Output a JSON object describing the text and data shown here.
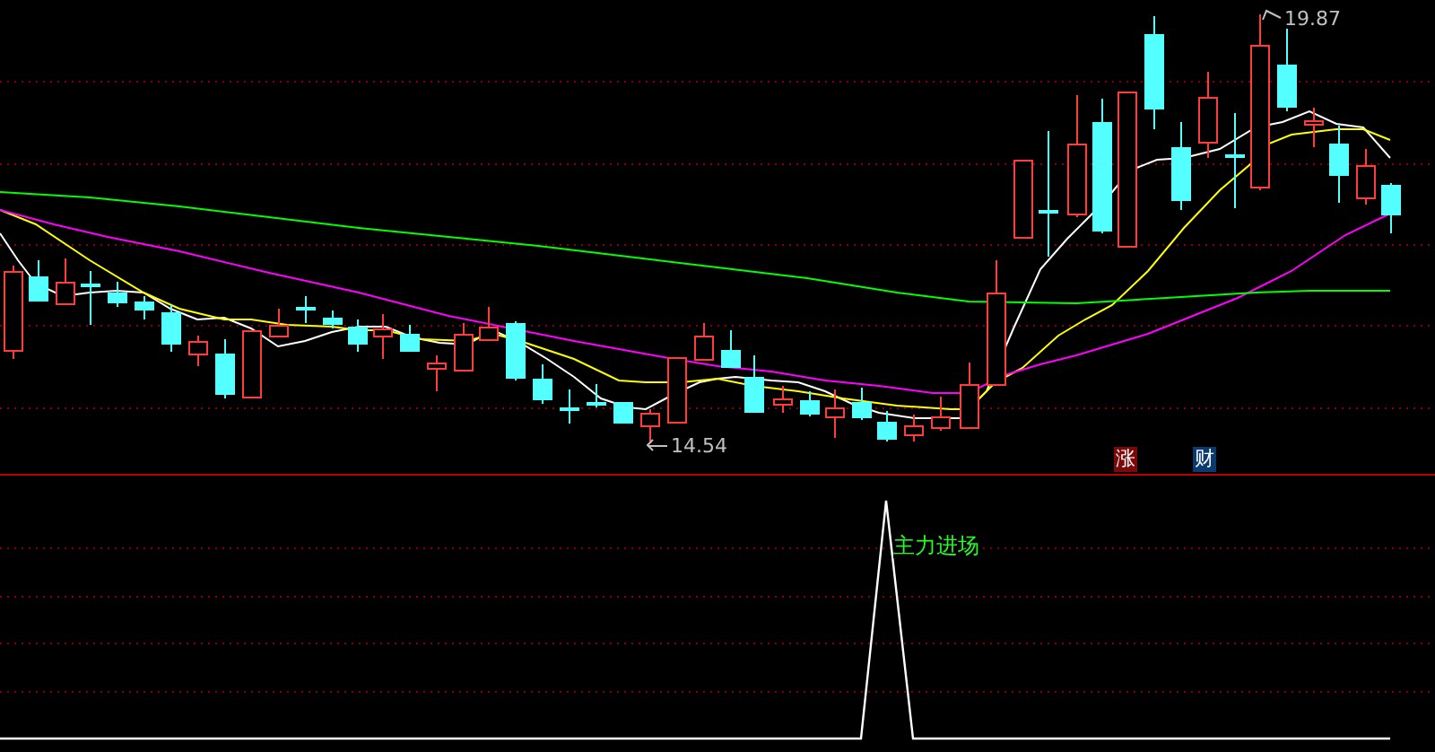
{
  "price_chart": {
    "high_label": "19.87",
    "low_label": "14.54",
    "badges": [
      {
        "text": "涨",
        "kind": "rise"
      },
      {
        "text": "财",
        "kind": "finance"
      }
    ]
  },
  "indicator_panel": {
    "signal_label": "主力进场"
  }
}
